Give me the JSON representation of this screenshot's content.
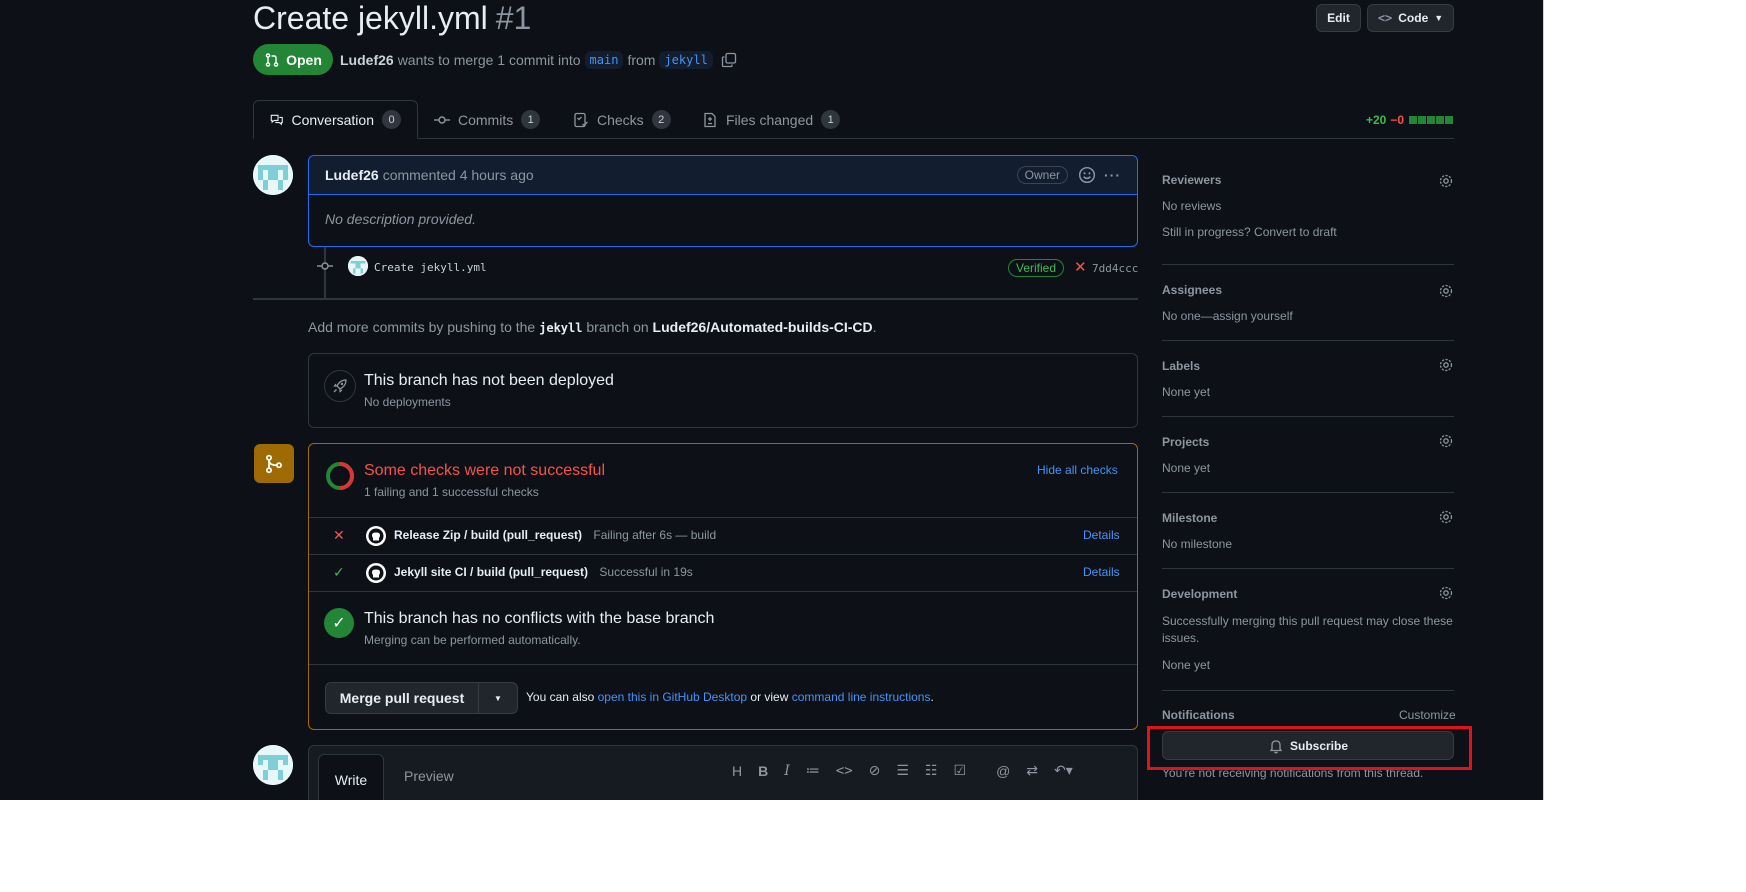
{
  "header": {
    "title": "Create jekyll.yml",
    "number": "#1",
    "edit_label": "Edit",
    "code_label": "Code",
    "state": "Open",
    "author": "Ludef26",
    "merge_text_1": "wants to merge 1 commit into",
    "base_branch": "main",
    "from_text": "from",
    "head_branch": "jekyll"
  },
  "tabs": [
    {
      "label": "Conversation",
      "count": "0"
    },
    {
      "label": "Commits",
      "count": "1"
    },
    {
      "label": "Checks",
      "count": "2"
    },
    {
      "label": "Files changed",
      "count": "1"
    }
  ],
  "diffstat": {
    "additions": "+20",
    "deletions": "−0"
  },
  "comment": {
    "author": "Ludef26",
    "action": "commented 4 hours ago",
    "role": "Owner",
    "body": "No description provided."
  },
  "commit": {
    "message": "Create jekyll.yml",
    "verified": "Verified",
    "sha": "7dd4ccc"
  },
  "push_note": {
    "prefix": "Add more commits by pushing to the",
    "branch": "jekyll",
    "middle": "branch on",
    "repo": "Ludef26/Automated-builds-CI-CD",
    "suffix": "."
  },
  "deploy": {
    "title": "This branch has not been deployed",
    "subtitle": "No deployments"
  },
  "checks": {
    "title": "Some checks were not successful",
    "subtitle": "1 failing and 1 successful checks",
    "hide_label": "Hide all checks",
    "items": [
      {
        "name": "Release Zip / build (pull_request)",
        "status": "Failing after 6s — build",
        "details": "Details"
      },
      {
        "name": "Jekyll site CI / build (pull_request)",
        "status": "Successful in 19s",
        "details": "Details"
      }
    ],
    "conflict_title": "This branch has no conflicts with the base branch",
    "conflict_subtitle": "Merging can be performed automatically.",
    "merge_button": "Merge pull request",
    "also_text": "You can also",
    "desktop_link": "open this in GitHub Desktop",
    "or_view": "or view",
    "cli_link": "command line instructions",
    "period": "."
  },
  "editor": {
    "write_tab": "Write",
    "preview_tab": "Preview"
  },
  "sidebar": {
    "reviewers": {
      "title": "Reviewers",
      "text1": "No reviews",
      "text2": "Still in progress? Convert to draft"
    },
    "assignees": {
      "title": "Assignees",
      "text": "No one—assign yourself"
    },
    "labels": {
      "title": "Labels",
      "text": "None yet"
    },
    "projects": {
      "title": "Projects",
      "text": "None yet"
    },
    "milestone": {
      "title": "Milestone",
      "text": "No milestone"
    },
    "development": {
      "title": "Development",
      "text": "Successfully merging this pull request may close these issues.",
      "text2": "None yet"
    },
    "notifications": {
      "title": "Notifications",
      "customize": "Customize",
      "subscribe": "Subscribe",
      "note": "You're not receiving notifications from this thread."
    }
  },
  "colors": {
    "accent": "#4493f8",
    "success": "#238636",
    "danger": "#f85149",
    "warning_border": "#9e6a03",
    "highlight": "#e0131b"
  }
}
